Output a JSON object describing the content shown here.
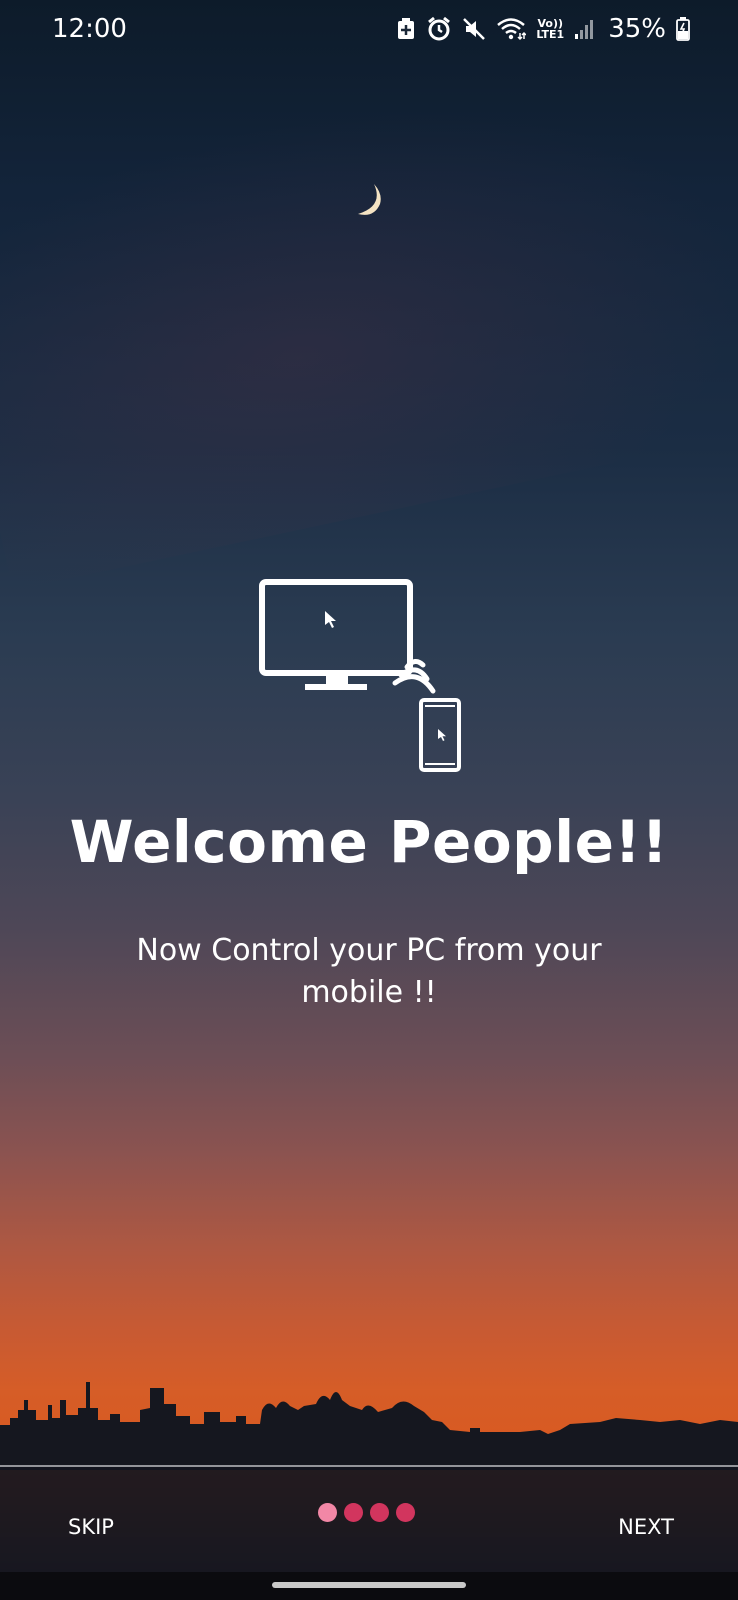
{
  "status_bar": {
    "time": "12:00",
    "battery": "35%",
    "network_top": "Vo))",
    "network_bottom": "LTE1",
    "icons": [
      "battery-saver-icon",
      "alarm-icon",
      "mute-icon",
      "wifi-icon",
      "volte-icon",
      "signal-icon",
      "battery-icon"
    ]
  },
  "onboarding": {
    "illustration_icon": "pc-to-mobile-icon",
    "title": "Welcome People!!",
    "subtitle": "Now Control your PC from your mobile !!"
  },
  "footer": {
    "skip_label": "SKIP",
    "next_label": "NEXT",
    "page_count": 4,
    "current_page": 1,
    "colors": {
      "dot_active": "#f287a6",
      "dot_inactive": "#d2355e"
    }
  }
}
